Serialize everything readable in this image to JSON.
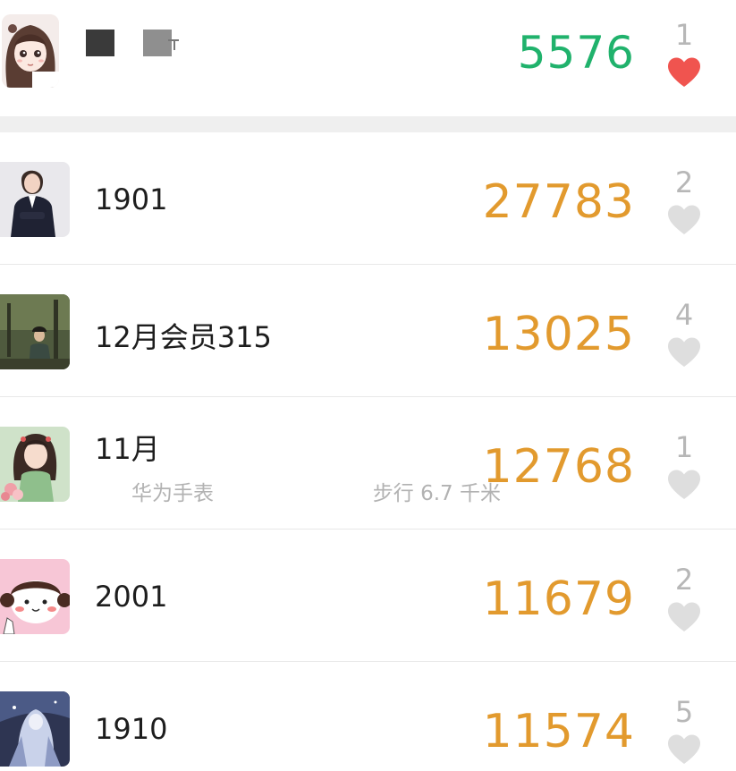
{
  "self": {
    "steps": "5576",
    "likes": "1",
    "liked": true,
    "avatar_icon": "girl-avatar"
  },
  "colors": {
    "self_steps": "#20b26c",
    "steps": "#e29a2e",
    "heart_liked": "#f0544f",
    "heart_unliked": "#dedede"
  },
  "list": [
    {
      "name": "1901",
      "steps": "27783",
      "likes": "2",
      "avatar_icon": "person-suit-avatar"
    },
    {
      "name": "12月会员315",
      "steps": "13025",
      "likes": "4",
      "avatar_icon": "painting-avatar"
    },
    {
      "name": "11月",
      "device": "华为手表",
      "distance": "步行 6.7 千米",
      "steps": "12768",
      "likes": "1",
      "avatar_icon": "girl-green-avatar"
    },
    {
      "name": "2001",
      "steps": "11679",
      "likes": "2",
      "avatar_icon": "cartoon-girl-avatar"
    },
    {
      "name": "1910",
      "steps": "11574",
      "likes": "5",
      "avatar_icon": "fantasy-avatar"
    }
  ]
}
